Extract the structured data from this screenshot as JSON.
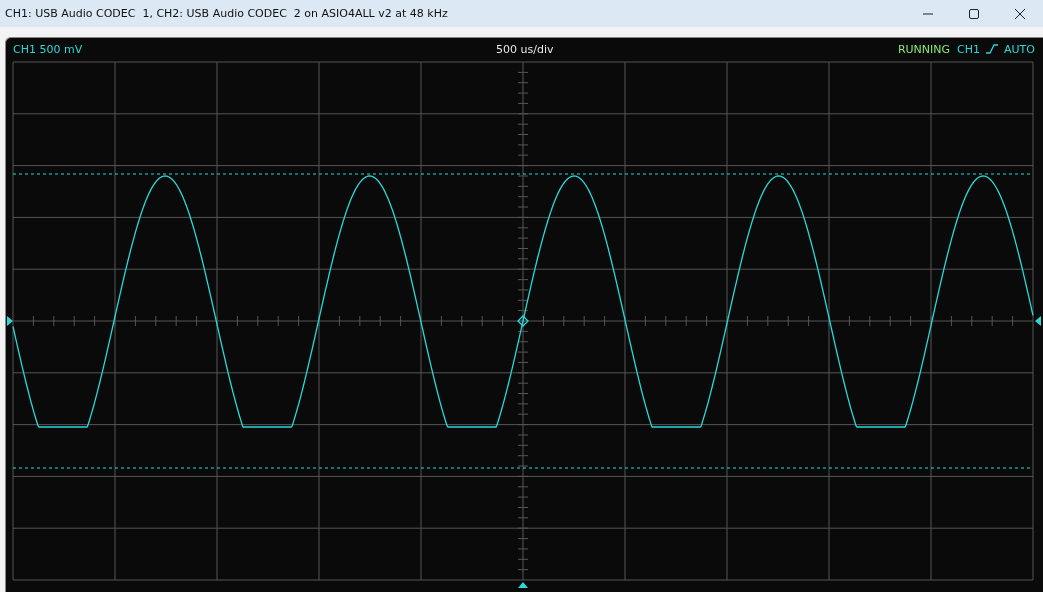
{
  "window": {
    "title": "CH1: USB Audio CODEC  1, CH2: USB Audio CODEC  2 on ASIO4ALL v2 at 48 kHz"
  },
  "scope": {
    "channel_scale": "CH1 500 mV",
    "timebase": "500 us/div",
    "run_status": "RUNNING",
    "trigger": {
      "channel": "CH1",
      "mode": "AUTO"
    }
  }
}
